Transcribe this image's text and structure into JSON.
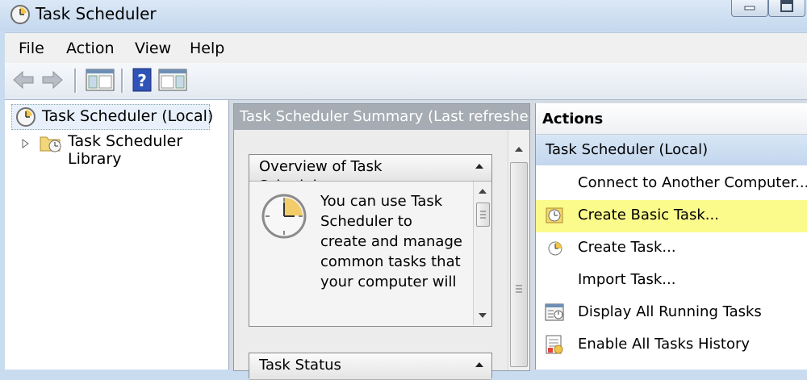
{
  "window": {
    "title": "Task Scheduler",
    "minimize_icon": "minimize-icon",
    "maximize_icon": "maximize-icon"
  },
  "menu": [
    "File",
    "Action",
    "View",
    "Help"
  ],
  "toolbar": {
    "icons": [
      "back-arrow-icon",
      "forward-arrow-icon",
      "show-hide-console-tree-icon",
      "help-icon",
      "show-hide-action-pane-icon"
    ]
  },
  "tree": {
    "root_label": "Task Scheduler (Local)",
    "child_label": "Task Scheduler Library"
  },
  "center": {
    "header": "Task Scheduler Summary (Last refreshed",
    "overview_title": "Overview of Task Scheduler",
    "overview_text": "You can use Task Scheduler to create and manage common tasks that your computer will",
    "status_title": "Task Status"
  },
  "actions": {
    "title": "Actions",
    "group": "Task Scheduler (Local)",
    "items": [
      {
        "label": "Connect to Another Computer...",
        "icon": ""
      },
      {
        "label": "Create Basic Task...",
        "icon": "create-basic-task-icon",
        "highlighted": true
      },
      {
        "label": "Create Task...",
        "icon": "create-task-icon"
      },
      {
        "label": "Import Task...",
        "icon": ""
      },
      {
        "label": "Display All Running Tasks",
        "icon": "running-tasks-icon"
      },
      {
        "label": "Enable All Tasks History",
        "icon": "tasks-history-icon"
      }
    ]
  },
  "colors": {
    "highlight": "#fbfb8c",
    "header_gray": "#a6acb3",
    "actions_group": "#c3d6ee"
  }
}
